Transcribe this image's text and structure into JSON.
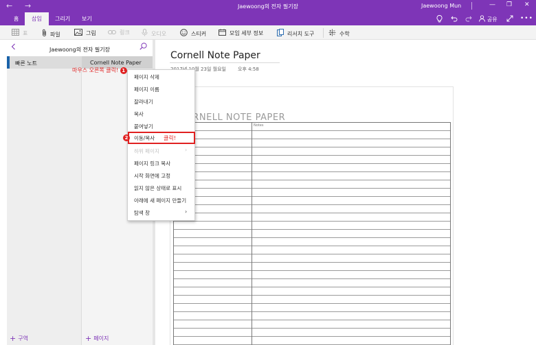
{
  "titlebar": {
    "title": "Jaewoong의 전자 필기장",
    "user": "Jaewoong Mun",
    "back": "←",
    "forward": "→",
    "minimize": "—",
    "restore": "❐",
    "close": "✕"
  },
  "tabs": [
    "홈",
    "삽입",
    "그리기",
    "보기"
  ],
  "ribbon_right": {
    "share_label": "공유"
  },
  "toolbar": {
    "table": "표",
    "file": "파일",
    "picture": "그림",
    "link": "링크",
    "audio": "오디오",
    "sticker": "스티커",
    "meeting": "모임 세부 정보",
    "researcher": "리서치 도구",
    "math": "수학"
  },
  "notebook": {
    "name": "Jaewoong의 전자 필기장",
    "sections": [
      {
        "label": "빠른 노트"
      }
    ],
    "pages": [
      {
        "label": "Cornell Note Paper"
      }
    ],
    "add_section": "구역",
    "add_page": "페이지"
  },
  "annotations": {
    "right_click": "마우스 오른쪽 클릭!",
    "step1": "1",
    "step2": "2",
    "click": "클릭!"
  },
  "context_menu": {
    "items": [
      {
        "label": "페이지 삭제"
      },
      {
        "label": "페이지 이름"
      },
      {
        "label": "잘라내기"
      },
      {
        "label": "복사"
      },
      {
        "label": "붙여넣기"
      },
      {
        "label": "이동/복사"
      },
      {
        "label": "하위 페이지"
      },
      {
        "label": "페이지 링크 복사"
      },
      {
        "label": "시작 화면에 고정"
      },
      {
        "label": "읽지 않은 상태로 표시"
      },
      {
        "label": "아래에 새 페이지 만들기"
      },
      {
        "label": "탐색 창"
      }
    ]
  },
  "page": {
    "title": "Cornell Note Paper",
    "date": "2017년 10월 23일 월요일",
    "time": "오후 4:58",
    "sheet_title": "CORNELL NOTE PAPER",
    "notes_label": "Notes"
  },
  "colors": {
    "accent": "#7e35b7",
    "section_marker": "#1a62a8",
    "annotation": "#e02020"
  }
}
